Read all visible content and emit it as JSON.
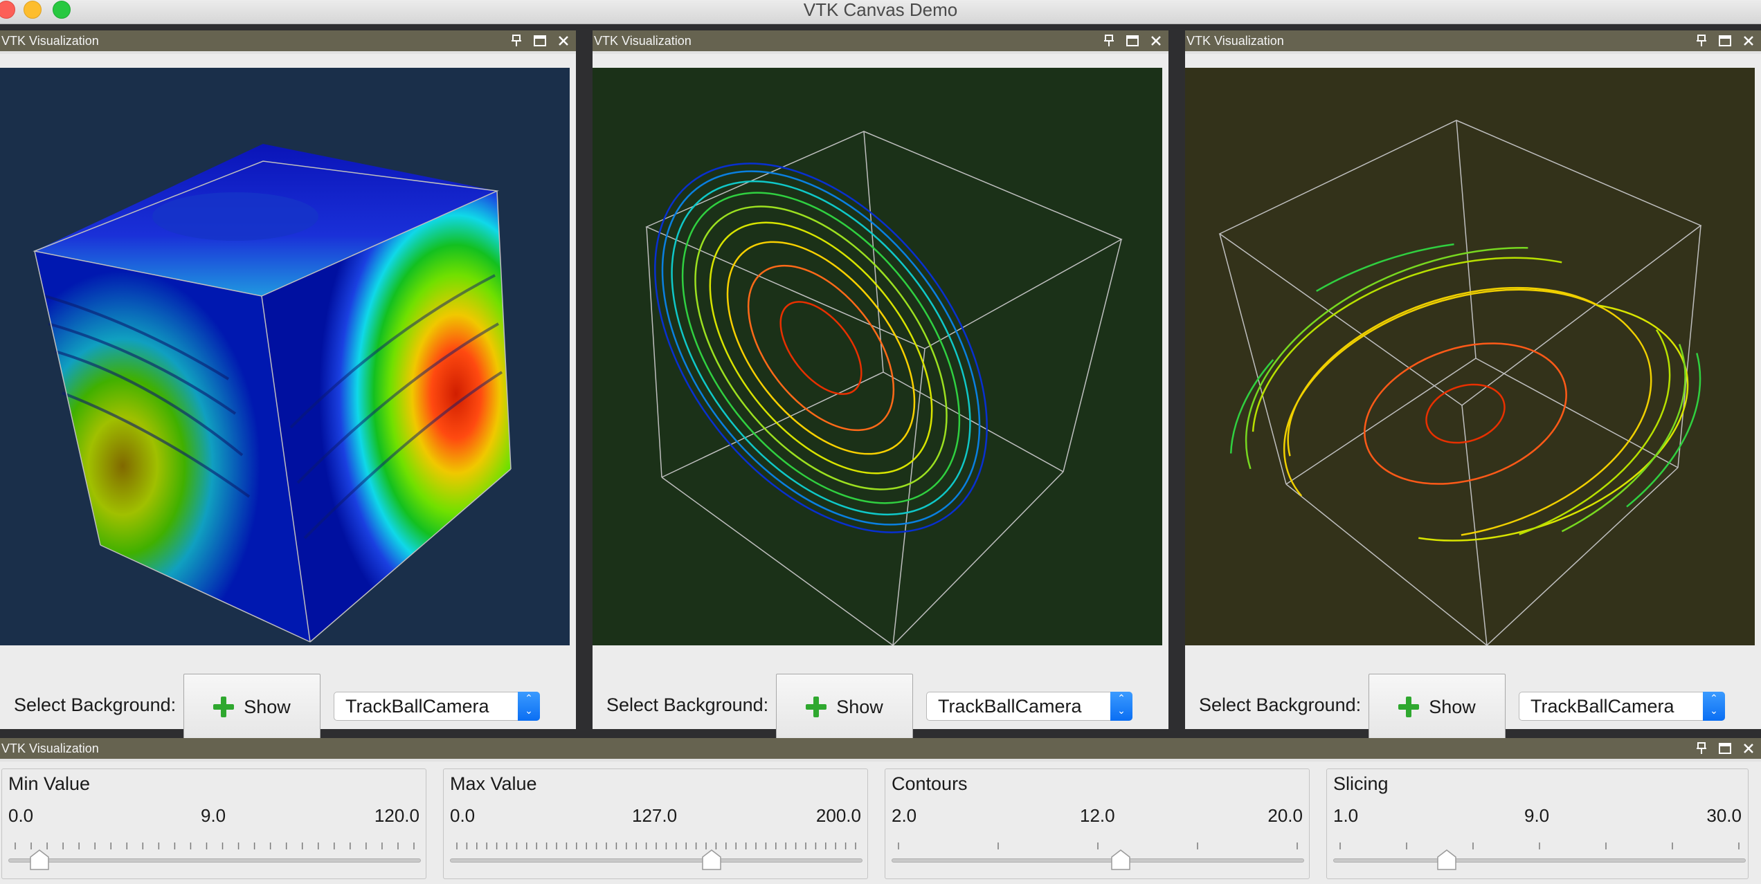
{
  "app": {
    "title": "VTK Canvas Demo"
  },
  "panels": [
    {
      "header": "VTK Visualization",
      "bg_color": "#1a2f4a",
      "controls": {
        "label": "Select Background:",
        "show_button": "Show",
        "camera_select": "TrackBallCamera"
      }
    },
    {
      "header": "VTK Visualization",
      "bg_color": "#1b3118",
      "controls": {
        "label": "Select Background:",
        "show_button": "Show",
        "camera_select": "TrackBallCamera"
      }
    },
    {
      "header": "VTK Visualization",
      "bg_color": "#33321a",
      "controls": {
        "label": "Select Background:",
        "show_button": "Show",
        "camera_select": "TrackBallCamera"
      }
    }
  ],
  "slider_panel": {
    "header": "VTK Visualization",
    "sliders": [
      {
        "title": "Min Value",
        "min": "0.0",
        "current": "9.0",
        "max": "120.0",
        "fraction": 0.075
      },
      {
        "title": "Max Value",
        "min": "0.0",
        "current": "127.0",
        "max": "200.0",
        "fraction": 0.635
      },
      {
        "title": "Contours",
        "min": "2.0",
        "current": "12.0",
        "max": "20.0",
        "fraction": 0.555
      },
      {
        "title": "Slicing",
        "min": "1.0",
        "current": "9.0",
        "max": "30.0",
        "fraction": 0.276
      }
    ]
  },
  "icons": {
    "pin": "pin-icon",
    "float": "float-icon",
    "close": "close-icon",
    "add": "plus-icon",
    "stepper": "up-down-chevron-icon"
  }
}
